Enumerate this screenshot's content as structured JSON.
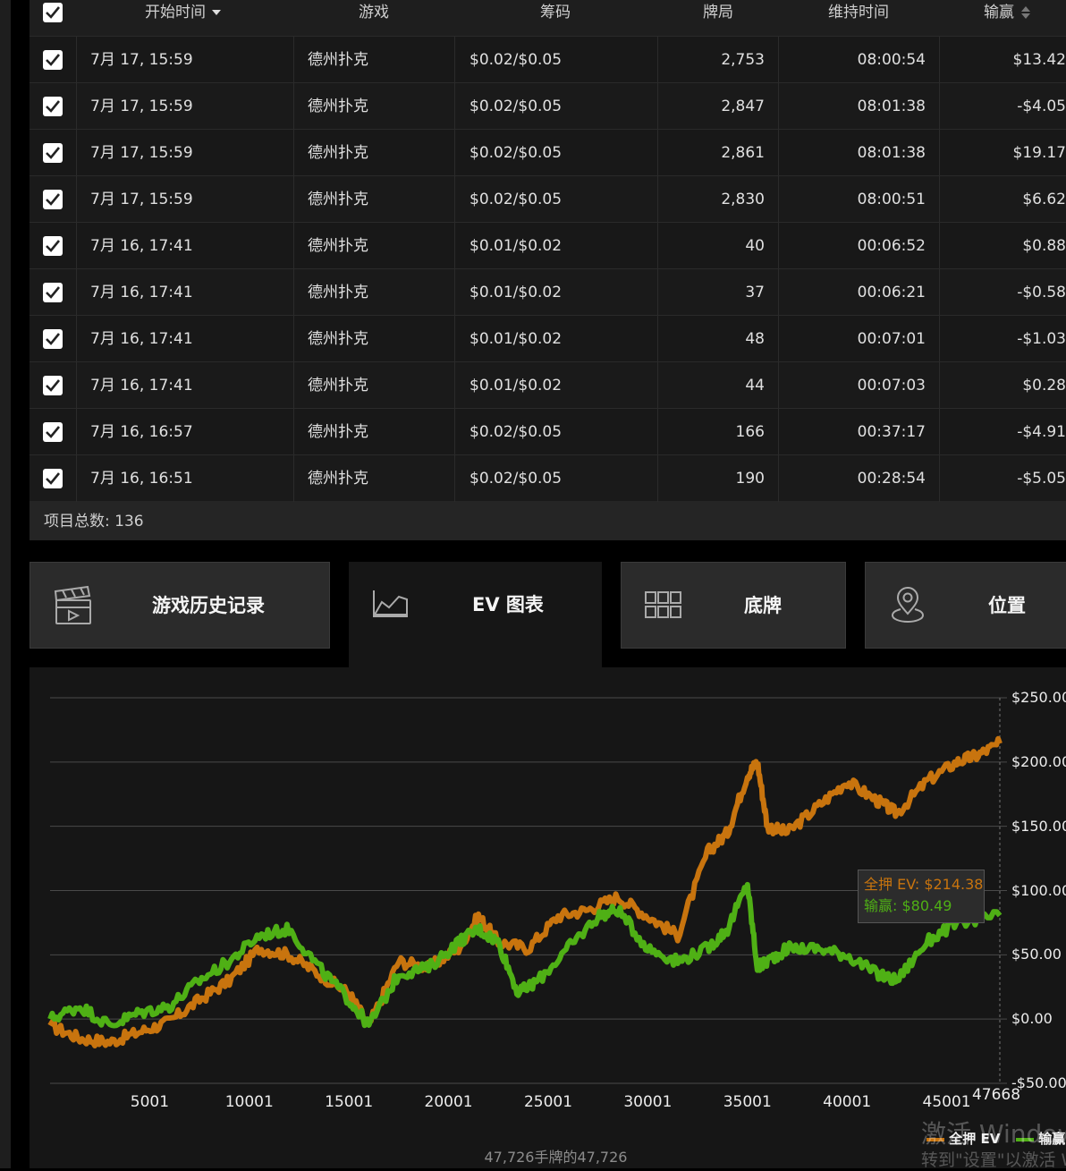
{
  "table": {
    "headers": {
      "start_time": "开始时间",
      "game": "游戏",
      "stakes": "筹码",
      "hands": "牌局",
      "duration": "维持时间",
      "winnings": "输赢"
    },
    "rows": [
      {
        "start_time": "7月 17, 15:59",
        "game": "德州扑克",
        "stakes": "$0.02/$0.05",
        "hands": "2,753",
        "duration": "08:00:54",
        "winnings": "$13.42"
      },
      {
        "start_time": "7月 17, 15:59",
        "game": "德州扑克",
        "stakes": "$0.02/$0.05",
        "hands": "2,847",
        "duration": "08:01:38",
        "winnings": "-$4.05"
      },
      {
        "start_time": "7月 17, 15:59",
        "game": "德州扑克",
        "stakes": "$0.02/$0.05",
        "hands": "2,861",
        "duration": "08:01:38",
        "winnings": "$19.17"
      },
      {
        "start_time": "7月 17, 15:59",
        "game": "德州扑克",
        "stakes": "$0.02/$0.05",
        "hands": "2,830",
        "duration": "08:00:51",
        "winnings": "$6.62"
      },
      {
        "start_time": "7月 16, 17:41",
        "game": "德州扑克",
        "stakes": "$0.01/$0.02",
        "hands": "40",
        "duration": "00:06:52",
        "winnings": "$0.88"
      },
      {
        "start_time": "7月 16, 17:41",
        "game": "德州扑克",
        "stakes": "$0.01/$0.02",
        "hands": "37",
        "duration": "00:06:21",
        "winnings": "-$0.58"
      },
      {
        "start_time": "7月 16, 17:41",
        "game": "德州扑克",
        "stakes": "$0.01/$0.02",
        "hands": "48",
        "duration": "00:07:01",
        "winnings": "-$1.03"
      },
      {
        "start_time": "7月 16, 17:41",
        "game": "德州扑克",
        "stakes": "$0.01/$0.02",
        "hands": "44",
        "duration": "00:07:03",
        "winnings": "$0.28"
      },
      {
        "start_time": "7月 16, 16:57",
        "game": "德州扑克",
        "stakes": "$0.02/$0.05",
        "hands": "166",
        "duration": "00:37:17",
        "winnings": "-$4.91"
      },
      {
        "start_time": "7月 16, 16:51",
        "game": "德州扑克",
        "stakes": "$0.02/$0.05",
        "hands": "190",
        "duration": "00:28:54",
        "winnings": "-$5.05"
      }
    ],
    "footer": "项目总数: 136"
  },
  "tabs": [
    {
      "label": "游戏历史记录",
      "icon": "clapperboard-icon",
      "active": false
    },
    {
      "label": "EV 图表",
      "icon": "area-chart-icon",
      "active": true
    },
    {
      "label": "底牌",
      "icon": "grid-icon",
      "active": false
    },
    {
      "label": "位置",
      "icon": "location-pin-icon",
      "active": false
    }
  ],
  "chart_data": {
    "type": "line",
    "x_ticks": [
      "5001",
      "10001",
      "15001",
      "20001",
      "25001",
      "30001",
      "35001",
      "40001",
      "45001"
    ],
    "x_end_label": "47668",
    "y_ticks": [
      "$250.00",
      "$200.00",
      "$150.00",
      "$100.00",
      "$50.00",
      "$0.00",
      "-$50.00"
    ],
    "ylim": [
      -50,
      250
    ],
    "xlim": [
      1,
      47668
    ],
    "grid": true,
    "legend_position": "bottom-right",
    "series": [
      {
        "name": "全押 EV",
        "color": "#c8740e",
        "x": [
          1,
          1500,
          3000,
          4500,
          6000,
          7500,
          9000,
          10500,
          12000,
          13500,
          15000,
          16000,
          17500,
          19000,
          20500,
          21500,
          22500,
          24000,
          25500,
          27000,
          28500,
          30000,
          31500,
          33000,
          34000,
          35000,
          35500,
          36000,
          37000,
          38500,
          40000,
          41500,
          42500,
          44000,
          45500,
          46500,
          47668
        ],
        "y": [
          -5,
          -15,
          -18,
          -10,
          -2,
          15,
          30,
          55,
          50,
          35,
          20,
          -5,
          45,
          40,
          55,
          80,
          60,
          55,
          80,
          85,
          95,
          80,
          65,
          130,
          145,
          190,
          200,
          150,
          145,
          165,
          185,
          170,
          160,
          185,
          200,
          205,
          214.38
        ]
      },
      {
        "name": "输赢",
        "color": "#4fb015",
        "x": [
          1,
          1500,
          3000,
          4500,
          6000,
          7500,
          9000,
          10500,
          12000,
          13500,
          15000,
          16000,
          17500,
          19000,
          20500,
          21500,
          22500,
          23500,
          24500,
          26000,
          27500,
          28500,
          30000,
          31500,
          33000,
          34000,
          35000,
          35500,
          36000,
          37000,
          38500,
          40000,
          41500,
          42500,
          44000,
          45500,
          47668
        ],
        "y": [
          0,
          10,
          -5,
          5,
          10,
          30,
          45,
          65,
          70,
          40,
          15,
          -5,
          35,
          40,
          60,
          70,
          60,
          20,
          30,
          55,
          80,
          85,
          55,
          45,
          55,
          70,
          105,
          40,
          45,
          55,
          55,
          50,
          35,
          30,
          60,
          75,
          80.49
        ]
      }
    ],
    "tooltip": {
      "ev_label": "全押 EV: $214.38",
      "net_label": "输赢: $80.49"
    },
    "caption": "47,726手牌的47,726"
  },
  "watermark": {
    "line1": "激活 Windows",
    "line2": "转到\"设置\"以激活 Windows。"
  },
  "colors": {
    "ev": "#c8740e",
    "net": "#4fb015",
    "background": "#161616"
  }
}
